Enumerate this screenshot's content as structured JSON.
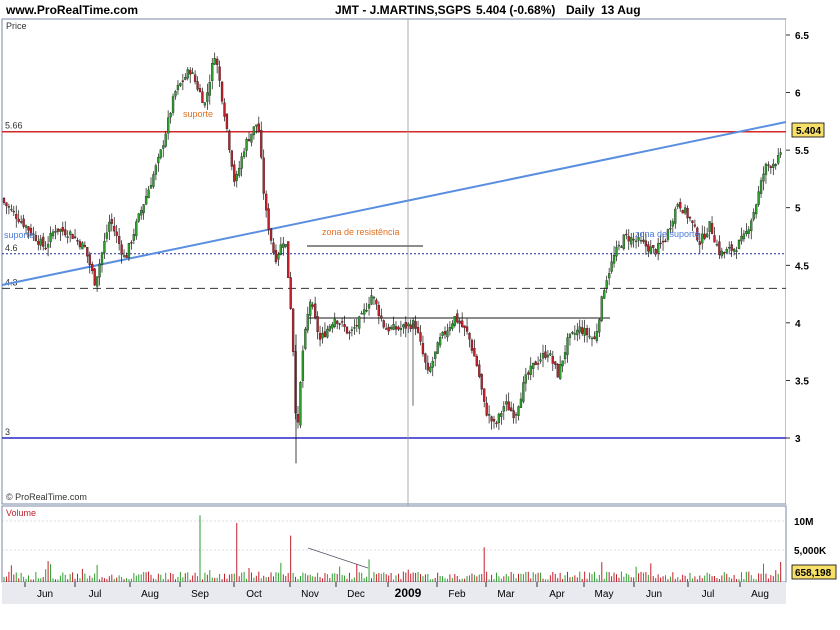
{
  "header": {
    "site": "www.ProRealTime.com",
    "symbol": "JMT - J.MARTINS,SGPS",
    "quote": "5.404 (-0.68%)",
    "period": "Daily",
    "date": "13 Aug"
  },
  "watermark": "© ProRealTime.com",
  "price_panel": {
    "title": "Price",
    "last_value": "5.404",
    "axis_ticks": [
      "6.5",
      "6",
      "5.5",
      "5",
      "4.5",
      "4",
      "3.5",
      "3"
    ],
    "levels": [
      {
        "label": "5.66",
        "value": 5.66,
        "color": "#d62728",
        "style": "solid"
      },
      {
        "label": "4.6",
        "value": 4.6,
        "color": "#1f2f8f",
        "style": "dotted"
      },
      {
        "label": "4.3",
        "value": 4.3,
        "color": "#333333",
        "style": "dashed"
      },
      {
        "label": "3",
        "value": 3.0,
        "color": "#2626c8",
        "style": "solid"
      }
    ],
    "annotations": [
      {
        "text": "suporte",
        "color": "#e07020"
      },
      {
        "text": "suporte",
        "color": "#4a78d8"
      },
      {
        "text": "zona de resistência",
        "color": "#e07020"
      },
      {
        "text": "zona de suporte",
        "color": "#4a78d8"
      }
    ]
  },
  "volume_panel": {
    "title": "Volume",
    "last_value": "658,198",
    "axis_ticks": [
      "10M",
      "5,000K"
    ]
  },
  "x_axis": [
    "Jun",
    "Jul",
    "Aug",
    "Sep",
    "Oct",
    "Nov",
    "Dec",
    "2009",
    "Feb",
    "Mar",
    "Apr",
    "May",
    "Jun",
    "Jul",
    "Aug"
  ],
  "colors": {
    "up": "#2e9e2e",
    "down": "#c0202a",
    "trendline": "#5a8fe0",
    "border": "#7a8aa8",
    "axis_bg": "#e8eaf0"
  },
  "chart_data": {
    "type": "candlestick",
    "title": "JMT - J.MARTINS,SGPS",
    "ylabel": "Price",
    "ylim": [
      2.7,
      6.6
    ],
    "series": [
      {
        "name": "JMT - J.MARTINS,SGPS",
        "approx_closes": [
          [
            0,
            5.08
          ],
          [
            25,
            4.85
          ],
          [
            45,
            4.65
          ],
          [
            55,
            4.82
          ],
          [
            70,
            4.78
          ],
          [
            85,
            4.65
          ],
          [
            95,
            4.35
          ],
          [
            110,
            4.9
          ],
          [
            125,
            4.55
          ],
          [
            140,
            4.95
          ],
          [
            160,
            5.45
          ],
          [
            175,
            6.0
          ],
          [
            190,
            6.2
          ],
          [
            205,
            5.9
          ],
          [
            215,
            6.35
          ],
          [
            225,
            5.8
          ],
          [
            235,
            5.2
          ],
          [
            245,
            5.55
          ],
          [
            258,
            5.75
          ],
          [
            265,
            5.0
          ],
          [
            275,
            4.55
          ],
          [
            285,
            4.75
          ],
          [
            292,
            4.0
          ],
          [
            297,
            2.95
          ],
          [
            302,
            3.7
          ],
          [
            310,
            4.2
          ],
          [
            320,
            3.85
          ],
          [
            335,
            4.05
          ],
          [
            350,
            3.9
          ],
          [
            362,
            4.05
          ],
          [
            372,
            4.25
          ],
          [
            385,
            3.95
          ],
          [
            400,
            3.95
          ],
          [
            415,
            4.0
          ],
          [
            428,
            3.55
          ],
          [
            440,
            3.85
          ],
          [
            455,
            4.05
          ],
          [
            468,
            3.9
          ],
          [
            478,
            3.6
          ],
          [
            485,
            3.25
          ],
          [
            495,
            3.1
          ],
          [
            505,
            3.3
          ],
          [
            515,
            3.2
          ],
          [
            525,
            3.5
          ],
          [
            535,
            3.65
          ],
          [
            548,
            3.75
          ],
          [
            558,
            3.55
          ],
          [
            568,
            3.85
          ],
          [
            580,
            3.95
          ],
          [
            595,
            3.85
          ],
          [
            605,
            4.35
          ],
          [
            615,
            4.6
          ],
          [
            625,
            4.75
          ],
          [
            640,
            4.7
          ],
          [
            655,
            4.62
          ],
          [
            665,
            4.72
          ],
          [
            678,
            5.05
          ],
          [
            690,
            4.9
          ],
          [
            700,
            4.7
          ],
          [
            710,
            4.85
          ],
          [
            720,
            4.6
          ],
          [
            735,
            4.65
          ],
          [
            745,
            4.75
          ],
          [
            755,
            5.0
          ],
          [
            765,
            5.35
          ],
          [
            775,
            5.4
          ],
          [
            782,
            5.45
          ]
        ]
      },
      {
        "name": "Volume",
        "approx_typical": "0.5M-1.5M",
        "spikes": [
          [
            201,
            11.5
          ],
          [
            236,
            10.2
          ],
          [
            290,
            8.0
          ],
          [
            485,
            6.0
          ]
        ]
      }
    ],
    "x_range": [
      "2008-05",
      "2009-08"
    ],
    "grid": false,
    "legend": "none"
  }
}
